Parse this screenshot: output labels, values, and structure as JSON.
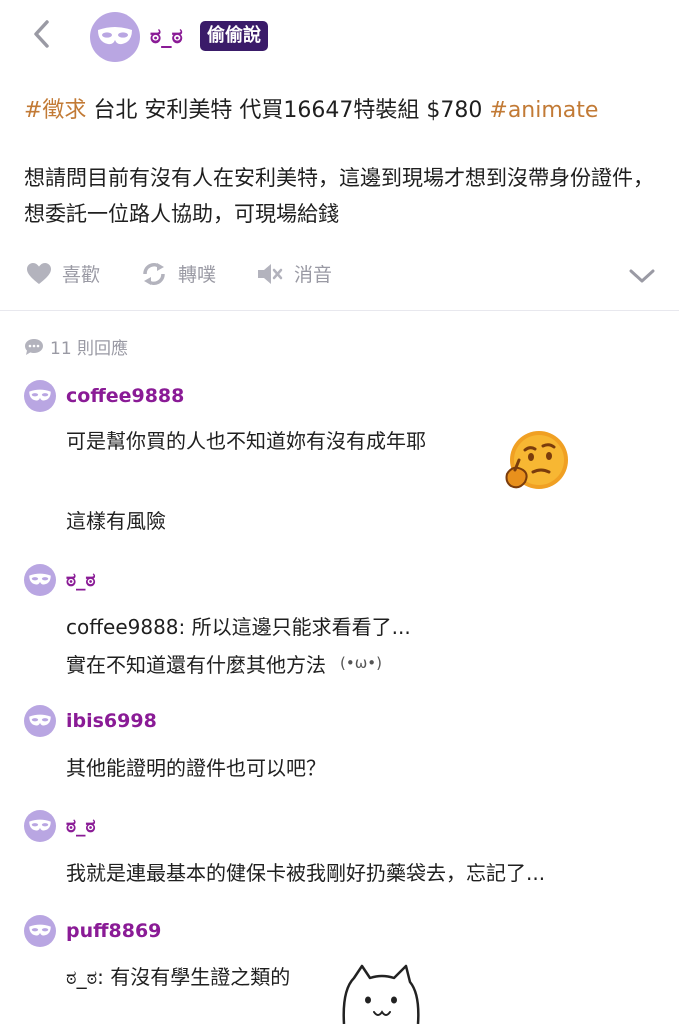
{
  "header": {
    "author": "ಠ_ಠ",
    "badge": "偷偷說"
  },
  "post": {
    "title_tag1": "#徵求",
    "title_text": " 台北 安利美特 代買16647特裝組 $780 ",
    "title_tag2": "#animate",
    "body": "想請問目前有沒有人在安利美特，這邊到現場才想到沒帶身份證件，想委託一位路人協助，可現場給錢"
  },
  "actions": {
    "like": "喜歡",
    "repost": "轉噗",
    "mute": "消音"
  },
  "replies": {
    "count_label": "11 則回應",
    "items": [
      {
        "name": "coffee9888",
        "lines": [
          "可是幫你買的人也不知道妳有沒有成年耶",
          "這樣有風險"
        ]
      },
      {
        "name": "ಠ_ಠ",
        "lines": [
          "coffee9888: 所以這邊只能求看看了...",
          "實在不知道還有什麼其他方法"
        ],
        "kaomoji": "(•ω•)"
      },
      {
        "name": "ibis6998",
        "lines": [
          "其他能證明的證件也可以吧？"
        ]
      },
      {
        "name": "ಠ_ಠ",
        "lines": [
          "我就是連最基本的健保卡被我剛好扔藥袋去，忘記了..."
        ]
      },
      {
        "name": "puff8869",
        "lines": [
          "ಠ_ಠ: 有沒有學生證之類的"
        ]
      }
    ]
  },
  "icons": {
    "back": "chevron-left-icon",
    "mask": "mask-icon",
    "like": "heart-icon",
    "repost": "repost-icon",
    "mute": "speaker-mute-icon",
    "expand": "chevron-down-icon",
    "reply": "speech-bubble-icon"
  },
  "colors": {
    "accent_name": "#8a1b96",
    "badge_bg": "#3a1b69",
    "tag": "#c27a35",
    "avatar_bg": "#b9a6e2",
    "muted": "#9a9aa4"
  }
}
